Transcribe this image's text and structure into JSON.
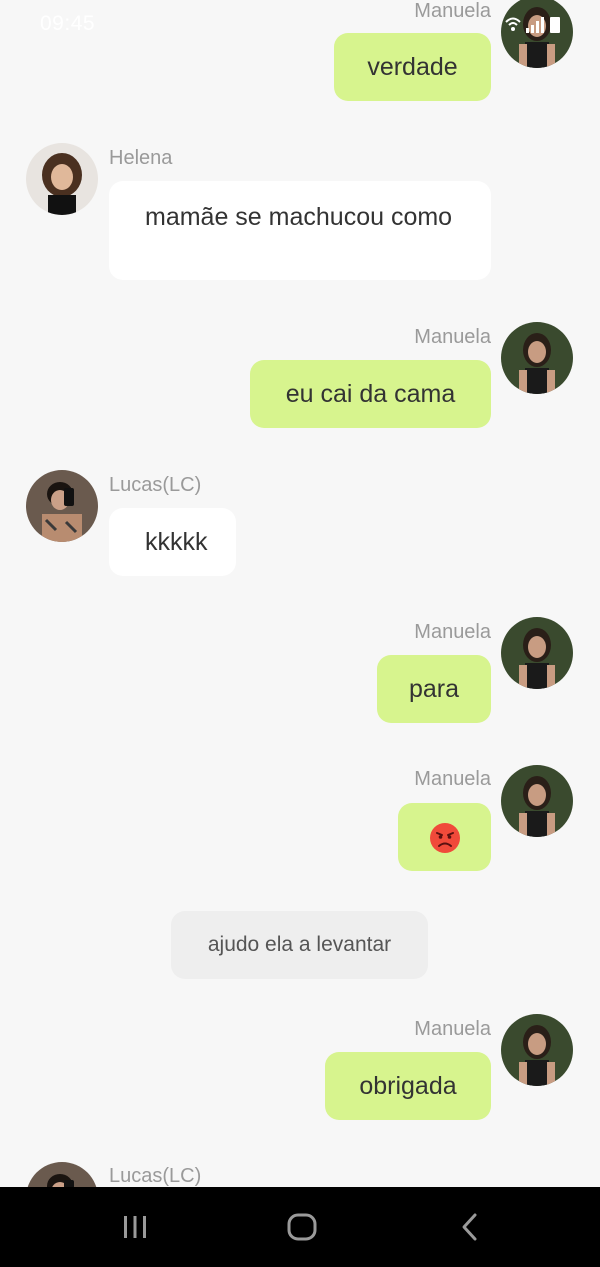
{
  "status_bar": {
    "time": "09:45"
  },
  "messages": [
    {
      "sender": "Manuela",
      "text": "verdade"
    },
    {
      "sender": "Helena",
      "text": "mamãe se machucou como"
    },
    {
      "sender": "Manuela",
      "text": "eu cai da cama"
    },
    {
      "sender": "Lucas(LC)",
      "text": "kkkkk"
    },
    {
      "sender": "Manuela",
      "text": "para"
    },
    {
      "sender": "Manuela",
      "emoji": "angry-face"
    },
    {
      "system": "ajudo ela a levantar"
    },
    {
      "sender": "Manuela",
      "text": "obrigada"
    },
    {
      "sender": "Lucas(LC)"
    }
  ],
  "colors": {
    "background": "#f7f7f7",
    "outgoing_bubble": "#d7f48e",
    "incoming_bubble": "#ffffff",
    "system_bubble": "#eeeeee",
    "sender_name": "#9a9a9a",
    "nav_bar": "#000000"
  },
  "nav_bar": {
    "icons": [
      "recent-apps-icon",
      "home-icon",
      "back-icon"
    ]
  }
}
